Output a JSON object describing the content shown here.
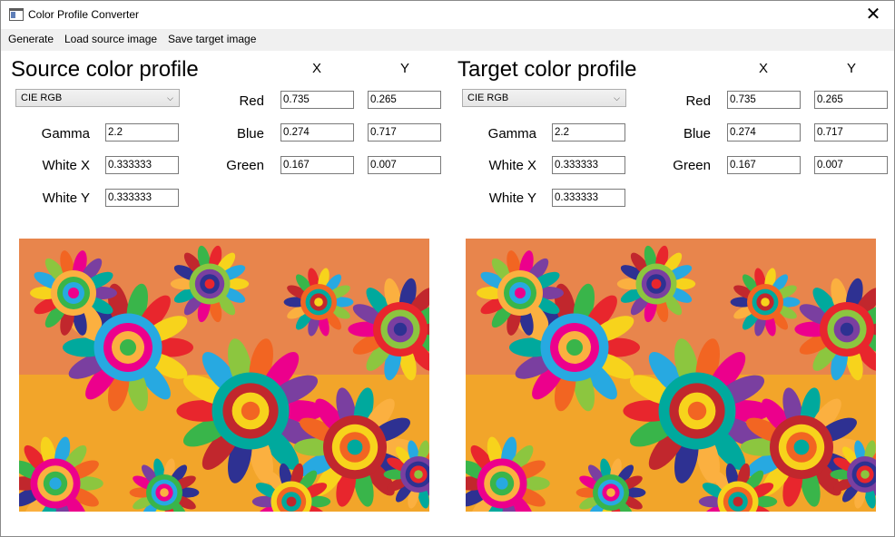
{
  "window": {
    "title": "Color Profile Converter",
    "close_glyph": "✕"
  },
  "menu": {
    "generate": "Generate",
    "load_source": "Load source image",
    "save_target": "Save target image"
  },
  "source": {
    "title": "Source color profile",
    "profile_selected": "CIE RGB",
    "gamma_label": "Gamma",
    "gamma": "2.2",
    "white_x_label": "White X",
    "white_x": "0.333333",
    "white_y_label": "White Y",
    "white_y": "0.333333",
    "x_header": "X",
    "y_header": "Y",
    "red_label": "Red",
    "red_x": "0.735",
    "red_y": "0.265",
    "blue_label": "Blue",
    "blue_x": "0.274",
    "blue_y": "0.717",
    "green_label": "Green",
    "green_x": "0.167",
    "green_y": "0.007"
  },
  "target": {
    "title": "Target color profile",
    "profile_selected": "CIE RGB",
    "gamma_label": "Gamma",
    "gamma": "2.2",
    "white_x_label": "White X",
    "white_x": "0.333333",
    "white_y_label": "White Y",
    "white_y": "0.333333",
    "x_header": "X",
    "y_header": "Y",
    "red_label": "Red",
    "red_x": "0.735",
    "red_y": "0.265",
    "blue_label": "Blue",
    "blue_x": "0.274",
    "blue_y": "0.717",
    "green_label": "Green",
    "green_x": "0.167",
    "green_y": "0.007"
  },
  "icons": {
    "app": "window-app-icon",
    "close": "close-icon",
    "dropdown": "chevron-down-icon"
  },
  "colors": {
    "menubar_bg": "#f0f0f0",
    "field_border": "#7a7a7a"
  }
}
